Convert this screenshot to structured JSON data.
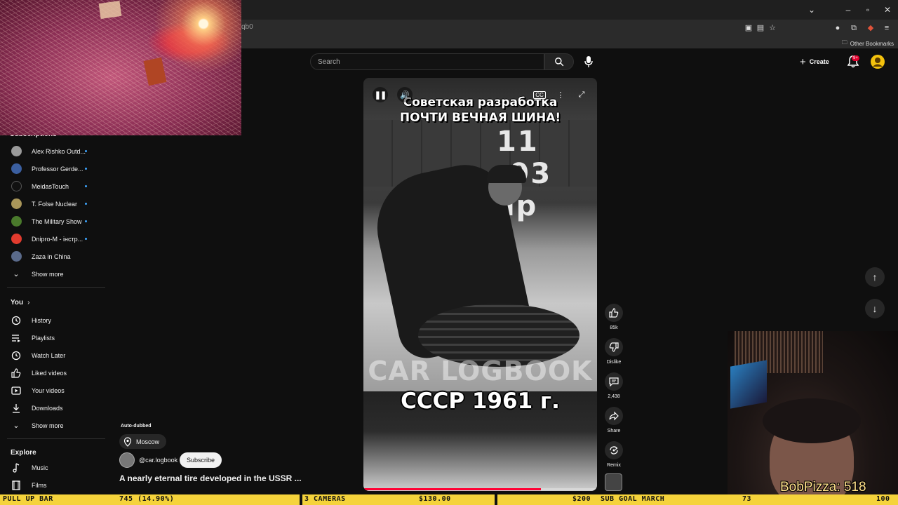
{
  "browser": {
    "url_fragment": "qb0",
    "other_bookmarks": "Other Bookmarks"
  },
  "header": {
    "search_placeholder": "Search",
    "create_label": "Create",
    "notification_badge": "9+"
  },
  "sidebar": {
    "subscriptions_title": "Subscriptions",
    "channels": [
      {
        "name": "Alex Rishko Outd...",
        "color": "#9a9a9a"
      },
      {
        "name": "Professor Gerde...",
        "color": "#3b5fa0"
      },
      {
        "name": "MeidasTouch",
        "color": "#111111"
      },
      {
        "name": "T. Folse Nuclear",
        "color": "#a9965a"
      },
      {
        "name": "The Military Show",
        "color": "#4a7a2c"
      },
      {
        "name": "Dnipro-M - інстр...",
        "color": "#e23b2e"
      },
      {
        "name": "Zaza in China",
        "color": "#5a6a8a"
      }
    ],
    "show_more_1": "Show more",
    "you_title": "You",
    "you_items": [
      {
        "label": "History"
      },
      {
        "label": "Playlists"
      },
      {
        "label": "Watch Later"
      },
      {
        "label": "Liked videos"
      },
      {
        "label": "Your videos"
      },
      {
        "label": "Downloads"
      }
    ],
    "show_more_2": "Show more",
    "explore_title": "Explore",
    "explore_items": [
      {
        "label": "Music"
      },
      {
        "label": "Films"
      }
    ]
  },
  "short": {
    "caption_line1": "Советская разработка",
    "caption_line2": "ПОЧТИ ВЕЧНАЯ ШИНА!",
    "truck_plate": "11 -93 яр",
    "watermark": "CAR LOGBOOK",
    "bottom_caption": "СССР 1961 г.",
    "progress": 0.76
  },
  "actions": {
    "likes": "85k",
    "dislike": "Dislike",
    "comments": "2,438",
    "share": "Share",
    "remix": "Remix"
  },
  "video_info": {
    "auto_dubbed": "Auto-dubbed",
    "location": "Moscow",
    "channel": "@car.logbook",
    "subscribe": "Subscribe",
    "title": "A nearly eternal tire developed in the USSR ..."
  },
  "overlay": {
    "bob_pizza": "BobPizza: 518"
  },
  "ticker": {
    "t1": "PULL UP BAR",
    "t2": "745 (14.90%)",
    "t3": "3 CAMERAS",
    "t4": "$130.00",
    "t5": "$200",
    "t6": "SUB GOAL MARCH",
    "t7": "73",
    "t8": "100"
  },
  "colors": {
    "accent_red": "#ff0033",
    "ticker_yellow": "#f5d33b",
    "link_blue": "#3ea6ff"
  }
}
